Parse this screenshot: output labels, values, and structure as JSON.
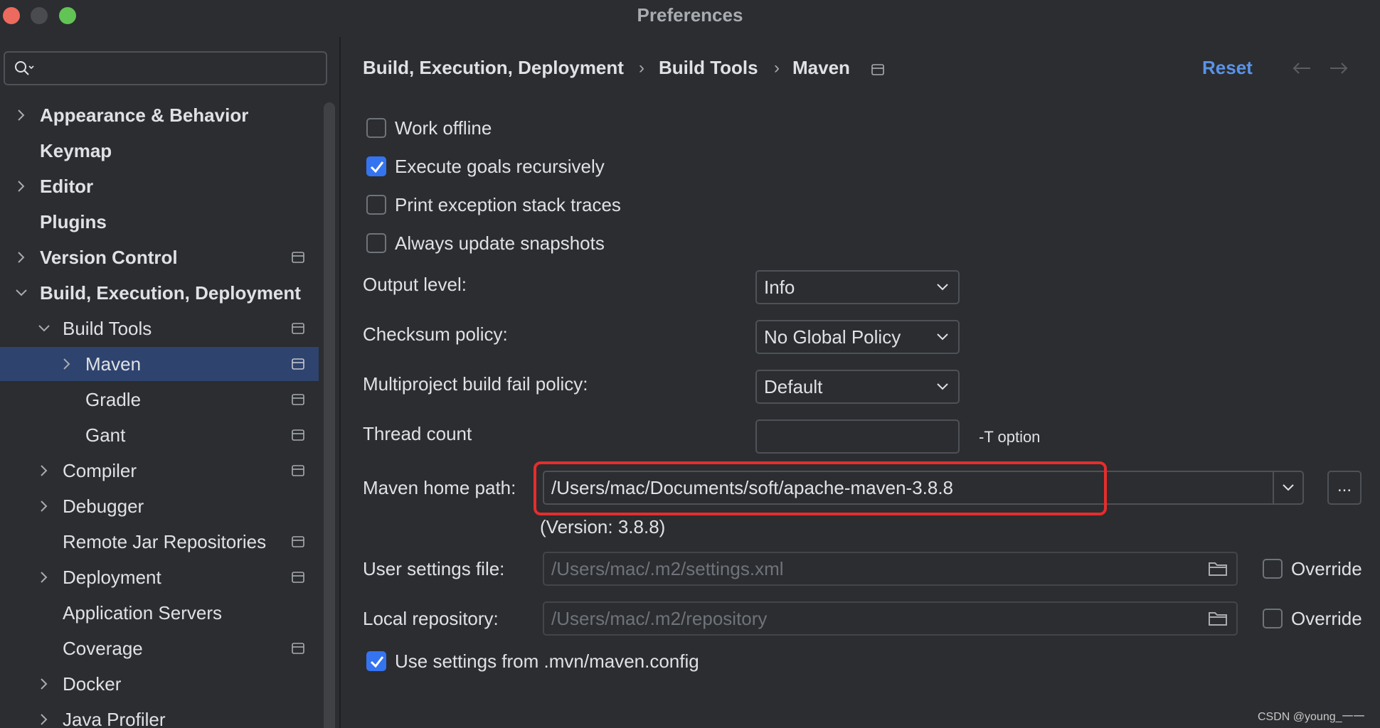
{
  "window": {
    "title": "Preferences"
  },
  "sidebar": {
    "search": {
      "placeholder": ""
    },
    "items": [
      {
        "label": "Appearance & Behavior"
      },
      {
        "label": "Keymap"
      },
      {
        "label": "Editor"
      },
      {
        "label": "Plugins"
      },
      {
        "label": "Version Control"
      },
      {
        "label": "Build, Execution, Deployment"
      },
      {
        "label": "Build Tools"
      },
      {
        "label": "Maven"
      },
      {
        "label": "Gradle"
      },
      {
        "label": "Gant"
      },
      {
        "label": "Compiler"
      },
      {
        "label": "Debugger"
      },
      {
        "label": "Remote Jar Repositories"
      },
      {
        "label": "Deployment"
      },
      {
        "label": "Application Servers"
      },
      {
        "label": "Coverage"
      },
      {
        "label": "Docker"
      },
      {
        "label": "Java Profiler"
      }
    ]
  },
  "header": {
    "breadcrumbs": [
      "Build, Execution, Deployment",
      "Build Tools",
      "Maven"
    ],
    "separator": "›",
    "reset_label": "Reset"
  },
  "options": {
    "work_offline": {
      "label": "Work offline",
      "checked": false
    },
    "execute_goals_recursively": {
      "label": "Execute goals recursively",
      "checked": true
    },
    "print_exception_stack_traces": {
      "label": "Print exception stack traces",
      "checked": false
    },
    "always_update_snapshots": {
      "label": "Always update snapshots",
      "checked": false
    }
  },
  "form": {
    "output_level": {
      "label": "Output level:",
      "value": "Info"
    },
    "checksum_policy": {
      "label": "Checksum policy:",
      "value": "No Global Policy"
    },
    "multiproject_fail_policy": {
      "label": "Multiproject build fail policy:",
      "value": "Default"
    },
    "thread_count": {
      "label": "Thread count",
      "value": "",
      "hint": "-T option"
    },
    "maven_home": {
      "label": "Maven home path:",
      "value": "/Users/mac/Documents/soft/apache-maven-3.8.8",
      "browse_label": "...",
      "version": "(Version: 3.8.8)"
    },
    "user_settings": {
      "label": "User settings file:",
      "value": "/Users/mac/.m2/settings.xml",
      "override_label": "Override",
      "override_checked": false
    },
    "local_repository": {
      "label": "Local repository:",
      "value": "/Users/mac/.m2/repository",
      "override_label": "Override",
      "override_checked": false
    },
    "use_mvn_config": {
      "label": "Use settings from .mvn/maven.config",
      "checked": true
    }
  },
  "watermark": "CSDN @young_一一",
  "colors": {
    "accent": "#3574f0",
    "link": "#5a93e8",
    "selection": "#2e436e",
    "highlight": "#e52d2d"
  }
}
